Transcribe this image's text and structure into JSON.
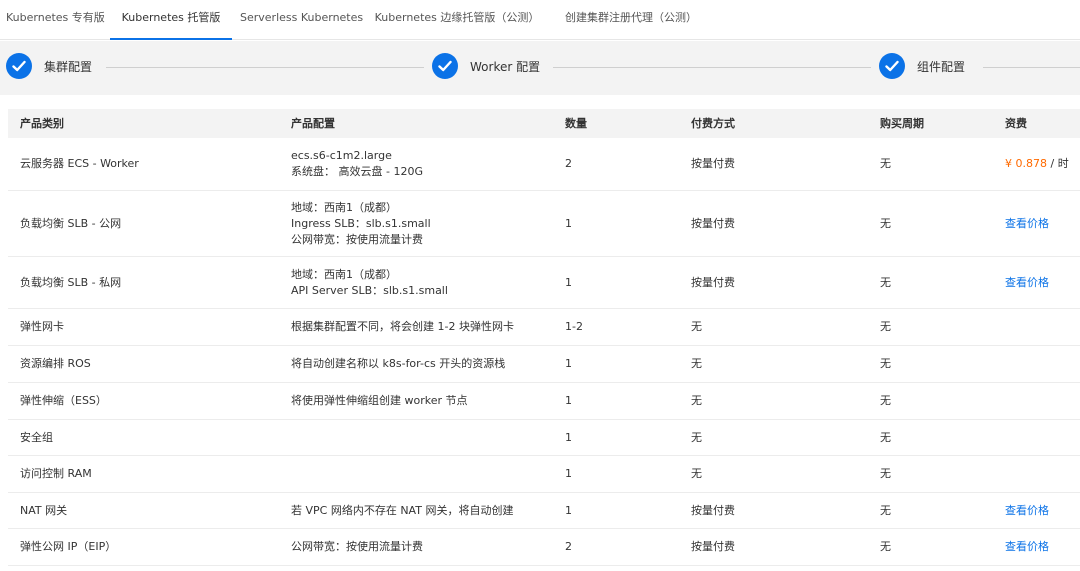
{
  "tabs": [
    {
      "label": "Kubernetes 专有版"
    },
    {
      "label": "Kubernetes 托管版"
    },
    {
      "label": "Serverless Kubernetes"
    },
    {
      "label": "Kubernetes 边缘托管版（公测）"
    },
    {
      "label": "创建集群注册代理（公测）"
    }
  ],
  "steps": [
    {
      "label": "集群配置"
    },
    {
      "label": "Worker 配置"
    },
    {
      "label": "组件配置"
    }
  ],
  "table": {
    "headers": {
      "category": "产品类别",
      "config": "产品配置",
      "quantity": "数量",
      "payment": "付费方式",
      "period": "购买周期",
      "fee": "资费"
    },
    "rows": [
      {
        "category": "云服务器 ECS - Worker",
        "config1": "ecs.s6-c1m2.large",
        "config2": "系统盘： 高效云盘 - 120G",
        "config3": "",
        "quantity": "2",
        "payment": "按量付费",
        "period": "无",
        "fee_price": "¥ 0.878",
        "fee_unit": " / 时",
        "fee_link": ""
      },
      {
        "category": "负载均衡 SLB - 公网",
        "config1": "地域：西南1（成都）",
        "config2": "Ingress SLB：slb.s1.small",
        "config3": "公网带宽：按使用流量计费",
        "quantity": "1",
        "payment": "按量付费",
        "period": "无",
        "fee_price": "",
        "fee_unit": "",
        "fee_link": "查看价格"
      },
      {
        "category": "负载均衡 SLB - 私网",
        "config1": "地域：西南1（成都）",
        "config2": "API Server SLB：slb.s1.small",
        "config3": "",
        "quantity": "1",
        "payment": "按量付费",
        "period": "无",
        "fee_price": "",
        "fee_unit": "",
        "fee_link": "查看价格"
      },
      {
        "category": "弹性网卡",
        "config1": "根据集群配置不同，将会创建 1-2 块弹性网卡",
        "config2": "",
        "config3": "",
        "quantity": "1-2",
        "payment": "无",
        "period": "无",
        "fee_price": "",
        "fee_unit": "",
        "fee_link": ""
      },
      {
        "category": "资源编排 ROS",
        "config1": "将自动创建名称以 k8s-for-cs 开头的资源栈",
        "config2": "",
        "config3": "",
        "quantity": "1",
        "payment": "无",
        "period": "无",
        "fee_price": "",
        "fee_unit": "",
        "fee_link": ""
      },
      {
        "category": "弹性伸缩（ESS）",
        "config1": "将使用弹性伸缩组创建 worker 节点",
        "config2": "",
        "config3": "",
        "quantity": "1",
        "payment": "无",
        "period": "无",
        "fee_price": "",
        "fee_unit": "",
        "fee_link": ""
      },
      {
        "category": "安全组",
        "config1": "",
        "config2": "",
        "config3": "",
        "quantity": "1",
        "payment": "无",
        "period": "无",
        "fee_price": "",
        "fee_unit": "",
        "fee_link": ""
      },
      {
        "category": "访问控制 RAM",
        "config1": "",
        "config2": "",
        "config3": "",
        "quantity": "1",
        "payment": "无",
        "period": "无",
        "fee_price": "",
        "fee_unit": "",
        "fee_link": ""
      },
      {
        "category": "NAT 网关",
        "config1": "若 VPC 网络内不存在 NAT 网关，将自动创建",
        "config2": "",
        "config3": "",
        "quantity": "1",
        "payment": "按量付费",
        "period": "无",
        "fee_price": "",
        "fee_unit": "",
        "fee_link": "查看价格"
      },
      {
        "category": "弹性公网 IP（EIP）",
        "config1": "公网带宽：按使用流量计费",
        "config2": "",
        "config3": "",
        "quantity": "2",
        "payment": "按量付费",
        "period": "无",
        "fee_price": "",
        "fee_unit": "",
        "fee_link": "查看价格"
      }
    ]
  },
  "colors": {
    "accent": "#0b72e7",
    "price": "#ff6a00"
  }
}
